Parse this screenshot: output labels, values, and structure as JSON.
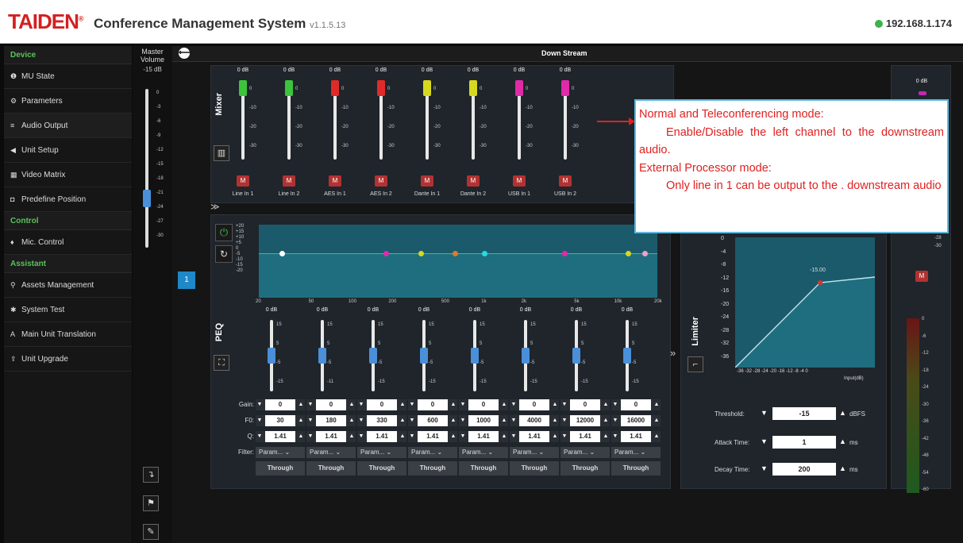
{
  "header": {
    "brand": "TAIDEN",
    "reg": "®",
    "title": "Conference Management System",
    "version": "v1.1.5.13",
    "ip": "192.168.1.174"
  },
  "sidebar": {
    "sections": [
      {
        "heading": "Device",
        "items": [
          {
            "label": "MU State",
            "icon": "info-icon"
          },
          {
            "label": "Parameters",
            "icon": "gears-icon"
          },
          {
            "label": "Audio Output",
            "icon": "sliders-icon",
            "active": true
          },
          {
            "label": "Unit Setup",
            "icon": "speaker-icon"
          },
          {
            "label": "Video Matrix",
            "icon": "grid-icon"
          },
          {
            "label": "Predefine Position",
            "icon": "camera-icon"
          }
        ]
      },
      {
        "heading": "Control",
        "items": [
          {
            "label": "Mic. Control",
            "icon": "microphone-icon"
          }
        ]
      },
      {
        "heading": "Assistant",
        "items": [
          {
            "label": "Assets Management",
            "icon": "location-icon"
          },
          {
            "label": "System Test",
            "icon": "bug-icon"
          },
          {
            "label": "Main Unit Translation",
            "icon": "translate-icon"
          },
          {
            "label": "Unit Upgrade",
            "icon": "upload-icon"
          }
        ]
      }
    ]
  },
  "master": {
    "label_line1": "Master",
    "label_line2": "Volume",
    "value": "-15 dB",
    "level": 0.31,
    "ticks": [
      "0",
      "-3",
      "-6",
      "-9",
      "-12",
      "-15",
      "-18",
      "-21",
      "-24",
      "-27",
      "-30"
    ]
  },
  "panel": {
    "title": "Down Stream",
    "channel_button": "1"
  },
  "mixer": {
    "label": "Mixer",
    "ticks": [
      "0",
      "-10",
      "-20",
      "-30"
    ],
    "channels": [
      {
        "name": "Line In 1",
        "gain": "0 dB",
        "color": "#3cc43c",
        "level": 1
      },
      {
        "name": "Line In 2",
        "gain": "0 dB",
        "color": "#3cc43c",
        "level": 1
      },
      {
        "name": "AES In 1",
        "gain": "0 dB",
        "color": "#e02a2a",
        "level": 1
      },
      {
        "name": "AES In 2",
        "gain": "0 dB",
        "color": "#e02a2a",
        "level": 1
      },
      {
        "name": "Dante In 1",
        "gain": "0 dB",
        "color": "#d8d81e",
        "level": 1
      },
      {
        "name": "Dante In 2",
        "gain": "0 dB",
        "color": "#d8d81e",
        "level": 1
      },
      {
        "name": "USB In 1",
        "gain": "0 dB",
        "color": "#e02aa8",
        "level": 1
      },
      {
        "name": "USB In 2",
        "gain": "0 dB",
        "color": "#e02aa8",
        "level": 1
      }
    ],
    "mute_label": "M"
  },
  "peq": {
    "label": "PEQ",
    "y_ticks": [
      "+20",
      "+15",
      "+10",
      "+5",
      "0",
      "-5",
      "-10",
      "-15",
      "-20"
    ],
    "x_ticks": [
      "20",
      "50",
      "100",
      "200",
      "500",
      "1k",
      "2k",
      "5k",
      "10k",
      "20k"
    ],
    "dots": [
      {
        "color": "#ffffff",
        "freq": 30
      },
      {
        "color": "#e02aa8",
        "freq": 180
      },
      {
        "color": "#d8d81e",
        "freq": 330
      },
      {
        "color": "#e07a2a",
        "freq": 600
      },
      {
        "color": "#2ad8e0",
        "freq": 1000
      },
      {
        "color": "#e02aa8",
        "freq": 4000
      },
      {
        "color": "#d8d81e",
        "freq": 12000
      },
      {
        "color": "#f0a0c8",
        "freq": 16000
      }
    ],
    "band_ticks": [
      "15",
      "5",
      "-5",
      "-15"
    ],
    "band_ticks_b": [
      "15",
      "5",
      "-5",
      "-11"
    ],
    "row_labels": {
      "gain": "Gain:",
      "f0": "F0:",
      "q": "Q:",
      "filter": "Filter:"
    },
    "bands": [
      {
        "top": "0 dB",
        "gain": "0",
        "f0": "30",
        "q": "1.41",
        "filter": "Param...",
        "through": "Through"
      },
      {
        "top": "0 dB",
        "gain": "0",
        "f0": "180",
        "q": "1.41",
        "filter": "Param...",
        "through": "Through"
      },
      {
        "top": "0 dB",
        "gain": "0",
        "f0": "330",
        "q": "1.41",
        "filter": "Param...",
        "through": "Through"
      },
      {
        "top": "0 dB",
        "gain": "0",
        "f0": "600",
        "q": "1.41",
        "filter": "Param...",
        "through": "Through"
      },
      {
        "top": "0 dB",
        "gain": "0",
        "f0": "1000",
        "q": "1.41",
        "filter": "Param...",
        "through": "Through"
      },
      {
        "top": "0 dB",
        "gain": "0",
        "f0": "4000",
        "q": "1.41",
        "filter": "Param...",
        "through": "Through"
      },
      {
        "top": "0 dB",
        "gain": "0",
        "f0": "12000",
        "q": "1.41",
        "filter": "Param...",
        "through": "Through"
      },
      {
        "top": "0 dB",
        "gain": "0",
        "f0": "16000",
        "q": "1.41",
        "filter": "Param...",
        "through": "Through"
      }
    ]
  },
  "limiter": {
    "label": "Limiter",
    "y_ticks": [
      "0",
      "-4",
      "-8",
      "-12",
      "-16",
      "-20",
      "-24",
      "-28",
      "-32",
      "-36"
    ],
    "x_ticks": "-36 -32 -28 -24 -20 -16 -12 -8 -4 0",
    "x_axis": "Input(dB)",
    "knee_label": "-15.00",
    "threshold": {
      "label": "Threshold:",
      "value": "-15",
      "unit": "dBFS"
    },
    "attack": {
      "label": "Attack Time:",
      "value": "1",
      "unit": "ms"
    },
    "decay": {
      "label": "Decay Time:",
      "value": "200",
      "unit": "ms"
    }
  },
  "output": {
    "gain": "0 dB",
    "ticks": [
      "-28",
      "-30"
    ],
    "mute": "M",
    "meter_ticks": [
      "0",
      "-6",
      "-12",
      "-18",
      "-24",
      "-30",
      "-36",
      "-42",
      "-48",
      "-54",
      "-60"
    ]
  },
  "annotation": {
    "line1": "Normal and Teleconferencing mode:",
    "line2": "Enable/Disable the left channel to the downstream audio.",
    "line3": "External Processor mode:",
    "line4": "Only line in 1 can be output to the . downstream audio"
  },
  "tools": {
    "icon1": "import-icon",
    "icon2": "flag-icon",
    "icon3": "wrench-icon"
  }
}
